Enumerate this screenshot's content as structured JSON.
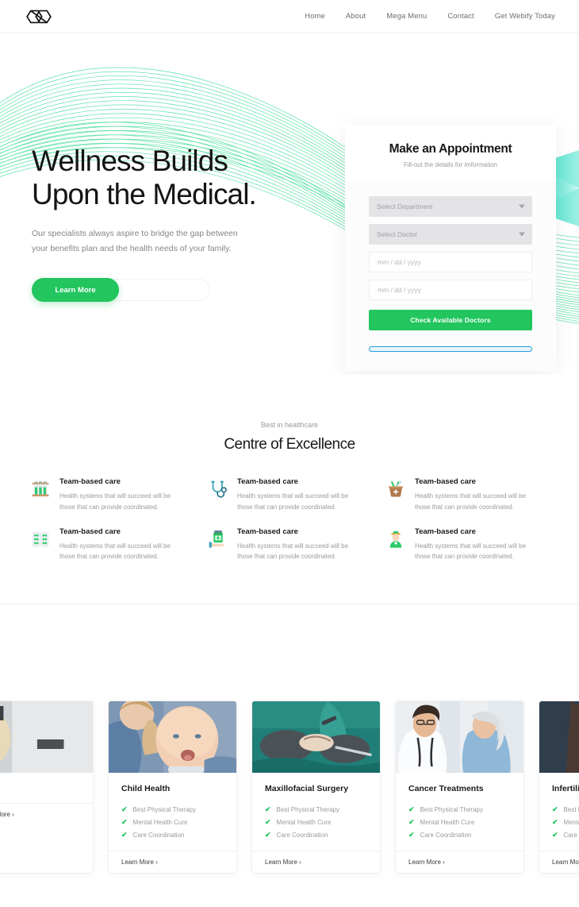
{
  "header": {
    "logo_icon": "hexagon-infinity-logo",
    "nav": [
      {
        "label": "Home"
      },
      {
        "label": "About"
      },
      {
        "label": "Mega Menu"
      },
      {
        "label": "Contact"
      },
      {
        "label": "Get Webify Today"
      }
    ]
  },
  "hero": {
    "title_line1": "Wellness Builds",
    "title_line2": "Upon the Medical.",
    "subtitle": "Our specialists always aspire to bridge the gap between your benefits plan and the health needs of your family.",
    "cta_label": "Learn More",
    "accent_color": "#22c55e",
    "wave_color": "#3ddc9a"
  },
  "appointment": {
    "title": "Make an Appointment",
    "subtitle": "Fill-out the details for imformation",
    "department_placeholder": "Select Department",
    "doctor_placeholder": "Select Doctor",
    "date_from_placeholder": "mm / dd / yyyy",
    "date_to_placeholder": "mm / dd / yyyy",
    "submit_label": "Check Available Doctors",
    "progress_color": "#1f9fe0"
  },
  "excellence": {
    "eyebrow": "Best in healthcare",
    "title": "Centre of Excellence",
    "features": [
      {
        "icon": "test-tubes-icon",
        "title": "Team-based care",
        "text": "Health systems that will succeed will be those that can provide coordinated."
      },
      {
        "icon": "stethoscope-icon",
        "title": "Team-based care",
        "text": "Health systems that will succeed will be those that can provide coordinated."
      },
      {
        "icon": "mortar-pestle-icon",
        "title": "Team-based care",
        "text": "Health systems that will succeed will be those that can provide coordinated."
      },
      {
        "icon": "pill-pack-icon",
        "title": "Team-based care",
        "text": "Health systems that will succeed will be those that can provide coordinated."
      },
      {
        "icon": "medicine-bottle-hand-icon",
        "title": "Team-based care",
        "text": "Health systems that will succeed will be those that can provide coordinated."
      },
      {
        "icon": "nurse-icon",
        "title": "Team-based care",
        "text": "Health systems that will succeed will be those that can provide coordinated."
      }
    ]
  },
  "services": {
    "link_label": "Learn More ›",
    "items": [
      {
        "title": "",
        "image": "gloved-hand-medical-photo",
        "features": []
      },
      {
        "title": "Child Health",
        "image": "mother-holding-baby-photo",
        "features": [
          "Best Physical Therapy",
          "Mental Health Cure",
          "Care Coordination"
        ]
      },
      {
        "title": "Maxillofacial Surgery",
        "image": "surgeons-operating-photo",
        "features": [
          "Best Physical Therapy",
          "Mental Health Cure",
          "Care Coordination"
        ]
      },
      {
        "title": "Cancer Treatments",
        "image": "doctor-with-elderly-patient-photo",
        "features": [
          "Best Physical Therapy",
          "Mental Health Cure",
          "Care Coordination"
        ]
      },
      {
        "title": "Infertility Care",
        "image": "hands-consultation-photo",
        "features": [
          "Best Physical Therapy",
          "Mental Health Cure",
          "Care Coordination"
        ]
      }
    ]
  }
}
